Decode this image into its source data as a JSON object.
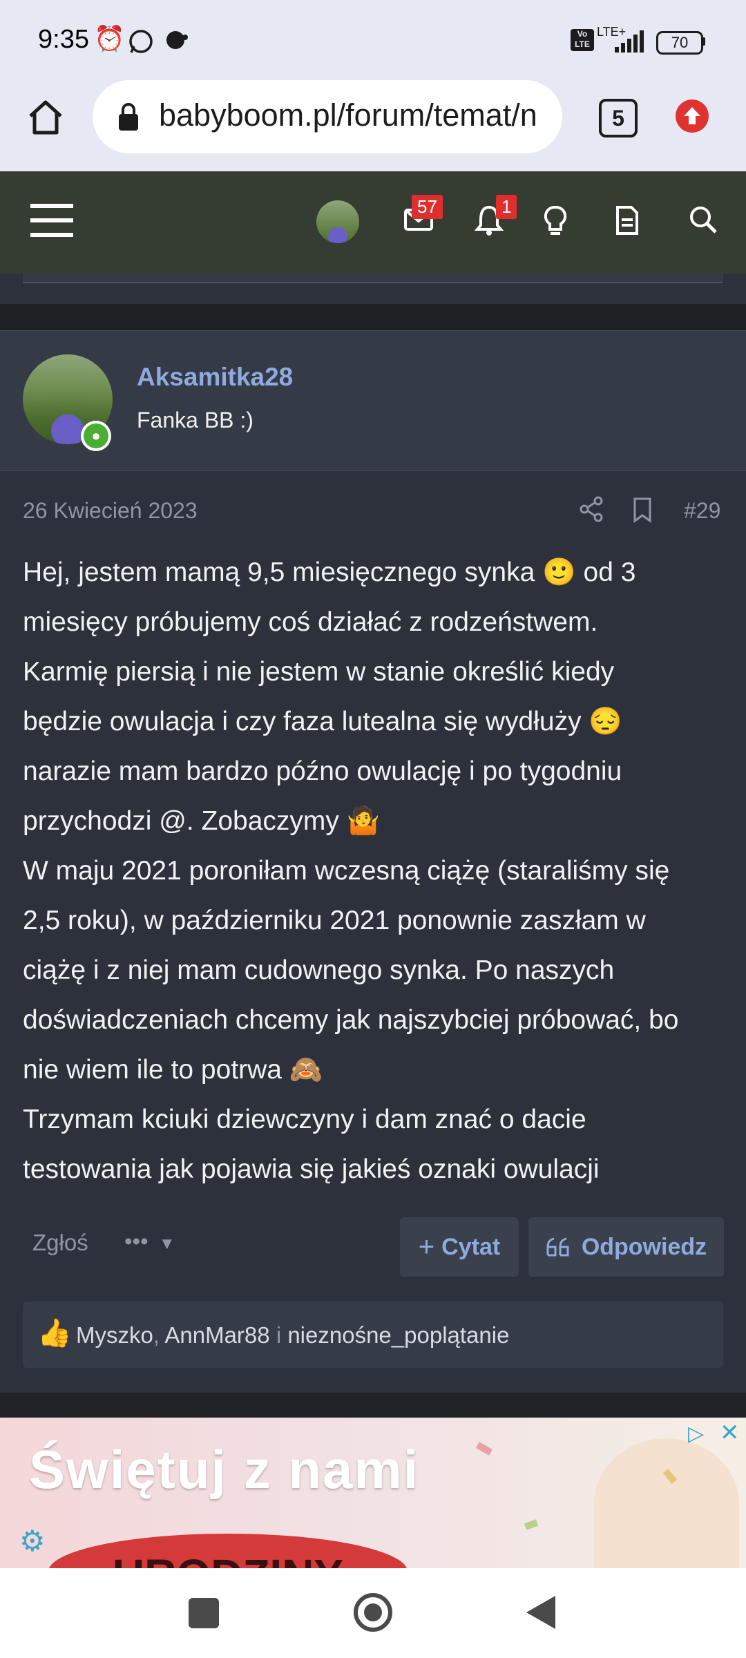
{
  "status_bar": {
    "time": "9:35",
    "battery": "70",
    "network": "LTE+"
  },
  "browser": {
    "url": "babyboom.pl/forum/temat/n",
    "tab_count": "5"
  },
  "forum_nav": {
    "messages_badge": "57",
    "alerts_badge": "1"
  },
  "post": {
    "author": "Aksamitka28",
    "author_title": "Fanka BB :)",
    "date": "26 Kwiecień 2023",
    "number": "#29",
    "body_lines": [
      "Hej, jestem mamą 9,5 miesięcznego synka 🙂 od 3",
      "miesięcy próbujemy coś działać z rodzeństwem.",
      "Karmię piersią i nie jestem w stanie określić kiedy",
      "będzie owulacja i czy faza lutealna się wydłuży 😔",
      "narazie mam bardzo późno owulację i po tygodniu",
      "przychodzi @. Zobaczymy 🤷",
      "W maju 2021 poroniłam wczesną ciążę (staraliśmy się",
      "2,5 roku), w październiku 2021 ponownie zaszłam w",
      "ciążę i z niej mam cudownego synka. Po naszych",
      "doświadczeniach chcemy jak najszybciej próbować, bo",
      "nie wiem ile to potrwa 🙈",
      "Trzymam kciuki dziewczyny i dam znać o dacie",
      "testowania jak pojawia się jakieś oznaki owulacji"
    ],
    "report_label": "Zgłoś",
    "more_label": "•••",
    "quote_label": "Cytat",
    "reply_label": "Odpowiedz",
    "likes": {
      "user1": "Myszko",
      "sep1": ",",
      "user2": "AnnMar88",
      "sep2": "i",
      "user3": "nieznośne_poplątanie"
    }
  },
  "ad": {
    "title": "Świętuj z nami",
    "subtitle": "URODZINY"
  },
  "colors": {
    "accent_link": "#8eaadf",
    "nav_bg": "#353d33",
    "post_bg": "#2c313b",
    "badge_red": "#e02e2e",
    "online_green": "#4bae33"
  }
}
